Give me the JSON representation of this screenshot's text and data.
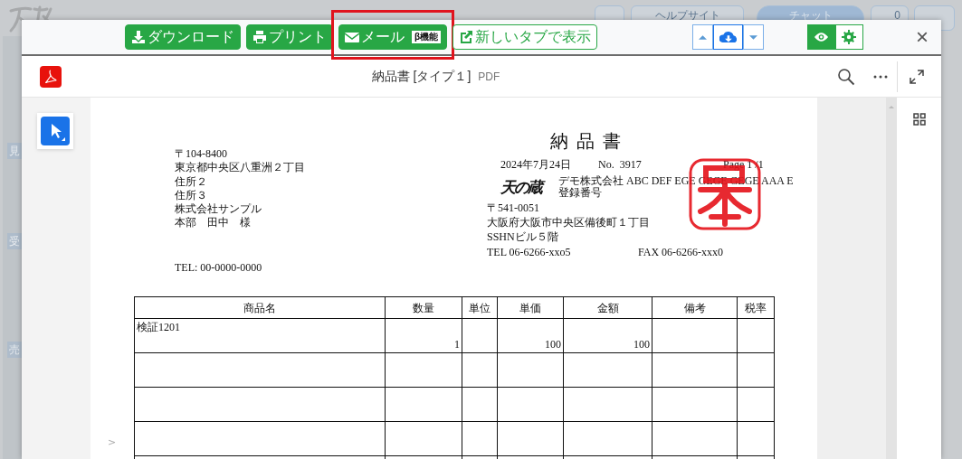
{
  "backdrop": {
    "side_labels": [
      "見",
      "受",
      "売"
    ],
    "header_buttons": [
      {
        "label": "ヘルプサイト",
        "selected": false
      },
      {
        "label": "チャット",
        "selected": true
      }
    ],
    "notification_count": "0"
  },
  "toolbar": {
    "buttons": [
      {
        "label": "ダウンロード",
        "kind": "solid",
        "highlighted": false
      },
      {
        "label": "プリント",
        "kind": "solid",
        "highlighted": false
      },
      {
        "label": "メール",
        "kind": "solid",
        "badge": "β機能",
        "highlighted": true
      },
      {
        "label": "新しいタブで表示",
        "kind": "outline",
        "highlighted": false
      }
    ],
    "nav_buttons": [
      {
        "selected": false
      },
      {
        "selected": true
      },
      {
        "selected": false
      }
    ],
    "view_buttons": [
      {
        "selected": true
      },
      {
        "selected": false
      }
    ],
    "close": "×"
  },
  "viewer": {
    "title": "納品書 [タイプ１]",
    "file_type": "PDF",
    "page_nav": ">"
  },
  "document": {
    "title": "納 品 書",
    "recipient_lines": [
      "〒104-8400",
      "東京都中央区八重洲２丁目",
      "住所２",
      "住所３",
      "株式会社サンプル",
      "本部　田中　様"
    ],
    "recipient_tel": "TEL: 00-0000-0000",
    "date": "2024年7月24日",
    "number": "No.  3917",
    "page": "Page 1 /1",
    "logo": "天の蔵",
    "sender_lines": [
      "デモ株式会社 ABC DEF EGE GEGE GEGE AAA E",
      "登録番号"
    ],
    "sender_address": [
      "〒541-0051",
      "大阪府大阪市中央区備後町１丁目",
      "SSHNビル５階"
    ],
    "sender_tel": "TEL 06-6266-xxo5",
    "sender_fax": "FAX 06-6266-xxx0",
    "table": {
      "columns": [
        "商品名",
        "数量",
        "単位",
        "単価",
        "金額",
        "備考",
        "税率"
      ],
      "rows": [
        {
          "product": "検証1201",
          "quantity": "1",
          "unit_price": "100",
          "amount": "100"
        },
        {},
        {},
        {},
        {}
      ]
    }
  }
}
